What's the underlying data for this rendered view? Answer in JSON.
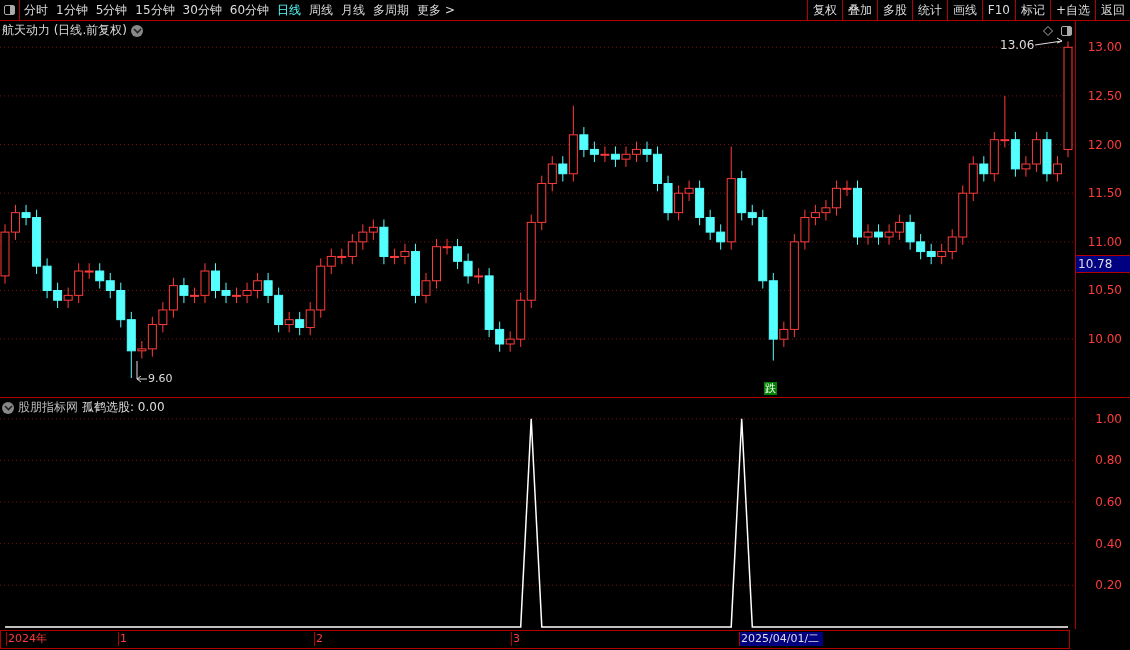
{
  "toolbar": {
    "periods": [
      {
        "label": "分时",
        "selected": false
      },
      {
        "label": "1分钟",
        "selected": false
      },
      {
        "label": "5分钟",
        "selected": false
      },
      {
        "label": "15分钟",
        "selected": false
      },
      {
        "label": "30分钟",
        "selected": false
      },
      {
        "label": "60分钟",
        "selected": false
      },
      {
        "label": "日线",
        "selected": true
      },
      {
        "label": "周线",
        "selected": false
      },
      {
        "label": "月线",
        "selected": false
      },
      {
        "label": "多周期",
        "selected": false
      },
      {
        "label": "更多 >",
        "selected": false
      }
    ],
    "actions": [
      "复权",
      "叠加",
      "多股",
      "统计",
      "画线",
      "F10",
      "标记",
      "+自选",
      "返回"
    ]
  },
  "price_chart": {
    "title": "航天动力 (日线.前复权)",
    "current_price": "10.78",
    "high_label": "13.06",
    "low_label": "9.60",
    "signal_marker": "跌",
    "chart_data": {
      "type": "candlestick",
      "grid": true,
      "ylim": [
        9.395,
        13.27
      ],
      "yticks": [
        {
          "value": 13,
          "label": "13.00"
        },
        {
          "value": 12.5,
          "label": "12.50"
        },
        {
          "value": 12,
          "label": "12.00"
        },
        {
          "value": 11.5,
          "label": "11.50"
        },
        {
          "value": 11,
          "label": "11.00"
        },
        {
          "value": 10.5,
          "label": "10.50"
        },
        {
          "value": 10,
          "label": "10.00"
        }
      ],
      "ohlc": [
        [
          10.65,
          11.18,
          10.57,
          11.1
        ],
        [
          11.1,
          11.38,
          11.02,
          11.3
        ],
        [
          11.3,
          11.38,
          11.17,
          11.25
        ],
        [
          11.25,
          11.33,
          10.67,
          10.75
        ],
        [
          10.75,
          10.83,
          10.42,
          10.5
        ],
        [
          10.5,
          10.58,
          10.32,
          10.4
        ],
        [
          10.4,
          10.53,
          10.32,
          10.45
        ],
        [
          10.45,
          10.78,
          10.37,
          10.7
        ],
        [
          10.7,
          10.78,
          10.62,
          10.7
        ],
        [
          10.7,
          10.78,
          10.52,
          10.6
        ],
        [
          10.6,
          10.68,
          10.42,
          10.5
        ],
        [
          10.5,
          10.58,
          10.12,
          10.2
        ],
        [
          10.2,
          10.28,
          9.6,
          9.88
        ],
        [
          9.88,
          9.98,
          9.8,
          9.9
        ],
        [
          9.9,
          10.23,
          9.82,
          10.15
        ],
        [
          10.15,
          10.38,
          10.07,
          10.3
        ],
        [
          10.3,
          10.63,
          10.22,
          10.55
        ],
        [
          10.55,
          10.63,
          10.37,
          10.45
        ],
        [
          10.45,
          10.53,
          10.37,
          10.45
        ],
        [
          10.45,
          10.78,
          10.37,
          10.7
        ],
        [
          10.7,
          10.78,
          10.42,
          10.5
        ],
        [
          10.5,
          10.58,
          10.37,
          10.45
        ],
        [
          10.45,
          10.53,
          10.37,
          10.45
        ],
        [
          10.45,
          10.58,
          10.37,
          10.5
        ],
        [
          10.5,
          10.68,
          10.42,
          10.6
        ],
        [
          10.6,
          10.68,
          10.37,
          10.45
        ],
        [
          10.45,
          10.53,
          10.07,
          10.15
        ],
        [
          10.15,
          10.28,
          10.07,
          10.2
        ],
        [
          10.2,
          10.28,
          10.04,
          10.12
        ],
        [
          10.12,
          10.38,
          10.04,
          10.3
        ],
        [
          10.3,
          10.83,
          10.22,
          10.75
        ],
        [
          10.75,
          10.93,
          10.67,
          10.85
        ],
        [
          10.85,
          10.93,
          10.77,
          10.85
        ],
        [
          10.85,
          11.08,
          10.77,
          11.0
        ],
        [
          11.0,
          11.18,
          10.92,
          11.1
        ],
        [
          11.1,
          11.23,
          11.02,
          11.15
        ],
        [
          11.15,
          11.23,
          10.77,
          10.85
        ],
        [
          10.85,
          10.93,
          10.77,
          10.85
        ],
        [
          10.85,
          10.98,
          10.77,
          10.9
        ],
        [
          10.9,
          10.98,
          10.37,
          10.45
        ],
        [
          10.45,
          10.68,
          10.37,
          10.6
        ],
        [
          10.6,
          11.03,
          10.52,
          10.95
        ],
        [
          10.95,
          11.03,
          10.87,
          10.95
        ],
        [
          10.95,
          11.03,
          10.72,
          10.8
        ],
        [
          10.8,
          10.88,
          10.57,
          10.65
        ],
        [
          10.65,
          10.73,
          10.57,
          10.65
        ],
        [
          10.65,
          10.73,
          10.02,
          10.1
        ],
        [
          10.1,
          10.18,
          9.87,
          9.95
        ],
        [
          9.95,
          10.08,
          9.87,
          10.0
        ],
        [
          10.0,
          10.48,
          9.92,
          10.4
        ],
        [
          10.4,
          11.28,
          10.32,
          11.2
        ],
        [
          11.2,
          11.68,
          11.12,
          11.6
        ],
        [
          11.6,
          11.88,
          11.52,
          11.8
        ],
        [
          11.8,
          11.88,
          11.62,
          11.7
        ],
        [
          11.7,
          12.4,
          11.62,
          12.1
        ],
        [
          12.1,
          12.18,
          11.87,
          11.95
        ],
        [
          11.95,
          12.03,
          11.82,
          11.9
        ],
        [
          11.9,
          11.98,
          11.82,
          11.9
        ],
        [
          11.9,
          11.98,
          11.77,
          11.85
        ],
        [
          11.85,
          11.98,
          11.77,
          11.9
        ],
        [
          11.9,
          12.03,
          11.82,
          11.95
        ],
        [
          11.95,
          12.03,
          11.82,
          11.9
        ],
        [
          11.9,
          11.98,
          11.52,
          11.6
        ],
        [
          11.6,
          11.68,
          11.22,
          11.3
        ],
        [
          11.3,
          11.58,
          11.22,
          11.5
        ],
        [
          11.5,
          11.63,
          11.42,
          11.55
        ],
        [
          11.55,
          11.63,
          11.17,
          11.25
        ],
        [
          11.25,
          11.33,
          11.02,
          11.1
        ],
        [
          11.1,
          11.18,
          10.92,
          11.0
        ],
        [
          11.0,
          11.98,
          10.92,
          11.65
        ],
        [
          11.65,
          11.73,
          11.22,
          11.3
        ],
        [
          11.3,
          11.38,
          11.17,
          11.25
        ],
        [
          11.25,
          11.33,
          10.52,
          10.6
        ],
        [
          10.6,
          10.68,
          9.78,
          10.0
        ],
        [
          10.0,
          10.18,
          9.92,
          10.1
        ],
        [
          10.1,
          11.08,
          10.02,
          11.0
        ],
        [
          11.0,
          11.33,
          10.92,
          11.25
        ],
        [
          11.25,
          11.38,
          11.17,
          11.3
        ],
        [
          11.3,
          11.43,
          11.22,
          11.35
        ],
        [
          11.35,
          11.63,
          11.27,
          11.55
        ],
        [
          11.55,
          11.63,
          11.47,
          11.55
        ],
        [
          11.55,
          11.63,
          10.97,
          11.05
        ],
        [
          11.05,
          11.18,
          10.97,
          11.1
        ],
        [
          11.1,
          11.18,
          10.97,
          11.05
        ],
        [
          11.05,
          11.18,
          10.97,
          11.1
        ],
        [
          11.1,
          11.28,
          11.02,
          11.2
        ],
        [
          11.2,
          11.28,
          10.92,
          11.0
        ],
        [
          11.0,
          11.08,
          10.82,
          10.9
        ],
        [
          10.9,
          10.98,
          10.77,
          10.85
        ],
        [
          10.85,
          10.98,
          10.77,
          10.9
        ],
        [
          10.9,
          11.13,
          10.82,
          11.05
        ],
        [
          11.05,
          11.58,
          10.97,
          11.5
        ],
        [
          11.5,
          11.88,
          11.42,
          11.8
        ],
        [
          11.8,
          11.88,
          11.62,
          11.7
        ],
        [
          11.7,
          12.13,
          11.62,
          12.05
        ],
        [
          12.05,
          12.5,
          11.97,
          12.05
        ],
        [
          12.05,
          12.13,
          11.67,
          11.75
        ],
        [
          11.75,
          11.88,
          11.67,
          11.8
        ],
        [
          11.8,
          12.13,
          11.72,
          12.05
        ],
        [
          12.05,
          12.13,
          11.62,
          11.7
        ],
        [
          11.7,
          11.88,
          11.62,
          11.8
        ],
        [
          11.95,
          13.06,
          11.87,
          13.0
        ]
      ]
    }
  },
  "indicator": {
    "title": "股朋指标网",
    "formula": "孤鹤选股: 0.00",
    "chart_data": {
      "type": "line",
      "series": [
        {
          "color": "#ffffff",
          "values": [
            0,
            0,
            0,
            0,
            0,
            0,
            0,
            0,
            0,
            0,
            0,
            0,
            0,
            0,
            0,
            0,
            0,
            0,
            0,
            0,
            0,
            0,
            0,
            0,
            0,
            0,
            0,
            0,
            0,
            0,
            0,
            0,
            0,
            0,
            0,
            0,
            0,
            0,
            0,
            0,
            0,
            0,
            0,
            0,
            0,
            0,
            0,
            0,
            0,
            0,
            1,
            0,
            0,
            0,
            0,
            0,
            0,
            0,
            0,
            0,
            0,
            0,
            0,
            0,
            0,
            0,
            0,
            0,
            0,
            0,
            1,
            0,
            0,
            0,
            0,
            0,
            0,
            0,
            0,
            0,
            0,
            0,
            0,
            0,
            0,
            0,
            0,
            0,
            0,
            0,
            0,
            0,
            0,
            0,
            0,
            0,
            0,
            0,
            0,
            0,
            0,
            0
          ]
        }
      ],
      "grid": true,
      "ylim": [
        -0.01,
        1.1
      ],
      "yticks": [
        {
          "value": 0.2,
          "label": "0.20"
        },
        {
          "value": 0.4,
          "label": "0.40"
        },
        {
          "value": 0.6,
          "label": "0.60"
        },
        {
          "value": 0.8,
          "label": "0.80"
        },
        {
          "value": 1,
          "label": "1.00"
        }
      ]
    }
  },
  "time_axis": [
    {
      "label": "2024年",
      "selected": false
    },
    {
      "label": "1",
      "selected": false
    },
    {
      "label": "2",
      "selected": false
    },
    {
      "label": "3",
      "selected": false
    },
    {
      "label": "2025/04/01/二",
      "selected": true
    }
  ]
}
